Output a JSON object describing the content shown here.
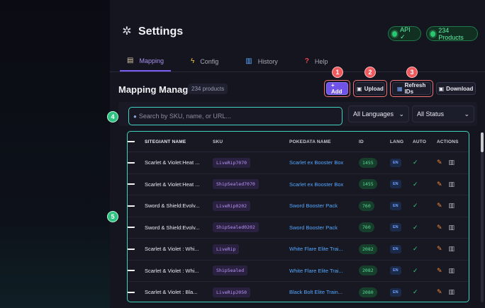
{
  "header": {
    "title": "Settings",
    "api_status": "API ✓",
    "products_status": "234 Products"
  },
  "tabs": [
    {
      "label": "Mapping",
      "icon": "clipboard-icon",
      "active": true
    },
    {
      "label": "Config",
      "icon": "bolt-icon",
      "active": false
    },
    {
      "label": "History",
      "icon": "bar-chart-icon",
      "active": false
    },
    {
      "label": "Help",
      "icon": "question-icon",
      "active": false
    }
  ],
  "manager": {
    "title": "Mapping Manager",
    "count": "234 products"
  },
  "toolbar": {
    "add_label": "+ Add",
    "upload_label": "Upload",
    "refresh_label": "Refresh IDs",
    "download_label": "Download"
  },
  "markers": [
    "1",
    "2",
    "3",
    "4",
    "5"
  ],
  "search": {
    "placeholder": "Search by SKU, name, or URL...",
    "language_select": "All Languages",
    "status_select": "All Status"
  },
  "table": {
    "columns": [
      "SITEGIANT NAME",
      "SKU",
      "POKEDATA NAME",
      "ID",
      "LANG",
      "AUTO",
      "ACTIONS"
    ],
    "rows": [
      {
        "name": "Scarlet & Violet:Heat ...",
        "sku": "LiveRip7070",
        "pokedata": "Scarlet ex Booster Box",
        "id": "1455",
        "lang": "EN",
        "auto": "✓"
      },
      {
        "name": "Scarlet & Violet:Heat ...",
        "sku": "ShipSealed7070",
        "pokedata": "Scarlet ex Booster Box",
        "id": "1455",
        "lang": "EN",
        "auto": "✓"
      },
      {
        "name": "Sword & Shield:Evolv...",
        "sku": "LiveRip0202",
        "pokedata": "Sword Booster Pack",
        "id": "760",
        "lang": "EN",
        "auto": "✓"
      },
      {
        "name": "Sword & Shield:Evolv...",
        "sku": "ShipSealed0202",
        "pokedata": "Sword Booster Pack",
        "id": "760",
        "lang": "EN",
        "auto": "✓"
      },
      {
        "name": "Scarlet & Violet : Whi...",
        "sku": "LiveRip",
        "pokedata": "White Flare Elite Trai...",
        "id": "2082",
        "lang": "EN",
        "auto": "✓"
      },
      {
        "name": "Scarlet & Violet : Whi...",
        "sku": "ShipSealed",
        "pokedata": "White Flare Elite Trai...",
        "id": "2082",
        "lang": "EN",
        "auto": "✓"
      },
      {
        "name": "Scarlet & Violet : Bla...",
        "sku": "LiveRip2050",
        "pokedata": "Black Bolt Elite Train...",
        "id": "2080",
        "lang": "EN",
        "auto": "✓"
      }
    ]
  },
  "colors": {
    "accent": "#6f52e8",
    "highlight_red": "#f07275",
    "highlight_teal": "#3fd3bf",
    "success": "#36c779",
    "link": "#55a7ff"
  }
}
